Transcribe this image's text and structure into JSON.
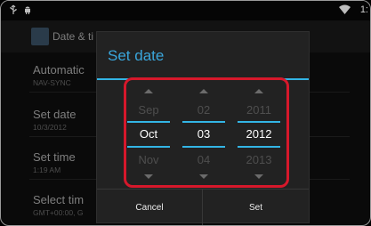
{
  "status_bar": {
    "time": "1:",
    "icons": [
      "usb-icon",
      "android-icon",
      "wifi-icon"
    ]
  },
  "background": {
    "title": "Date & ti",
    "items": [
      {
        "title": "Automatic",
        "subtitle": "NAV-SYNC"
      },
      {
        "title": "Set date",
        "subtitle": "10/3/2012"
      },
      {
        "title": "Set time",
        "subtitle": "1:19 AM"
      },
      {
        "title": "Select tim",
        "subtitle": "GMT+00:00, G"
      }
    ]
  },
  "dialog": {
    "title": "Set date",
    "pickers": {
      "month": {
        "prev": "Sep",
        "current": "Oct",
        "next": "Nov"
      },
      "day": {
        "prev": "02",
        "current": "03",
        "next": "04"
      },
      "year": {
        "prev": "2011",
        "current": "2012",
        "next": "2013"
      }
    },
    "buttons": {
      "cancel": "Cancel",
      "set": "Set"
    }
  },
  "colors": {
    "accent": "#33b5e5",
    "highlight": "#d6182b",
    "dialog_bg": "#222222"
  }
}
